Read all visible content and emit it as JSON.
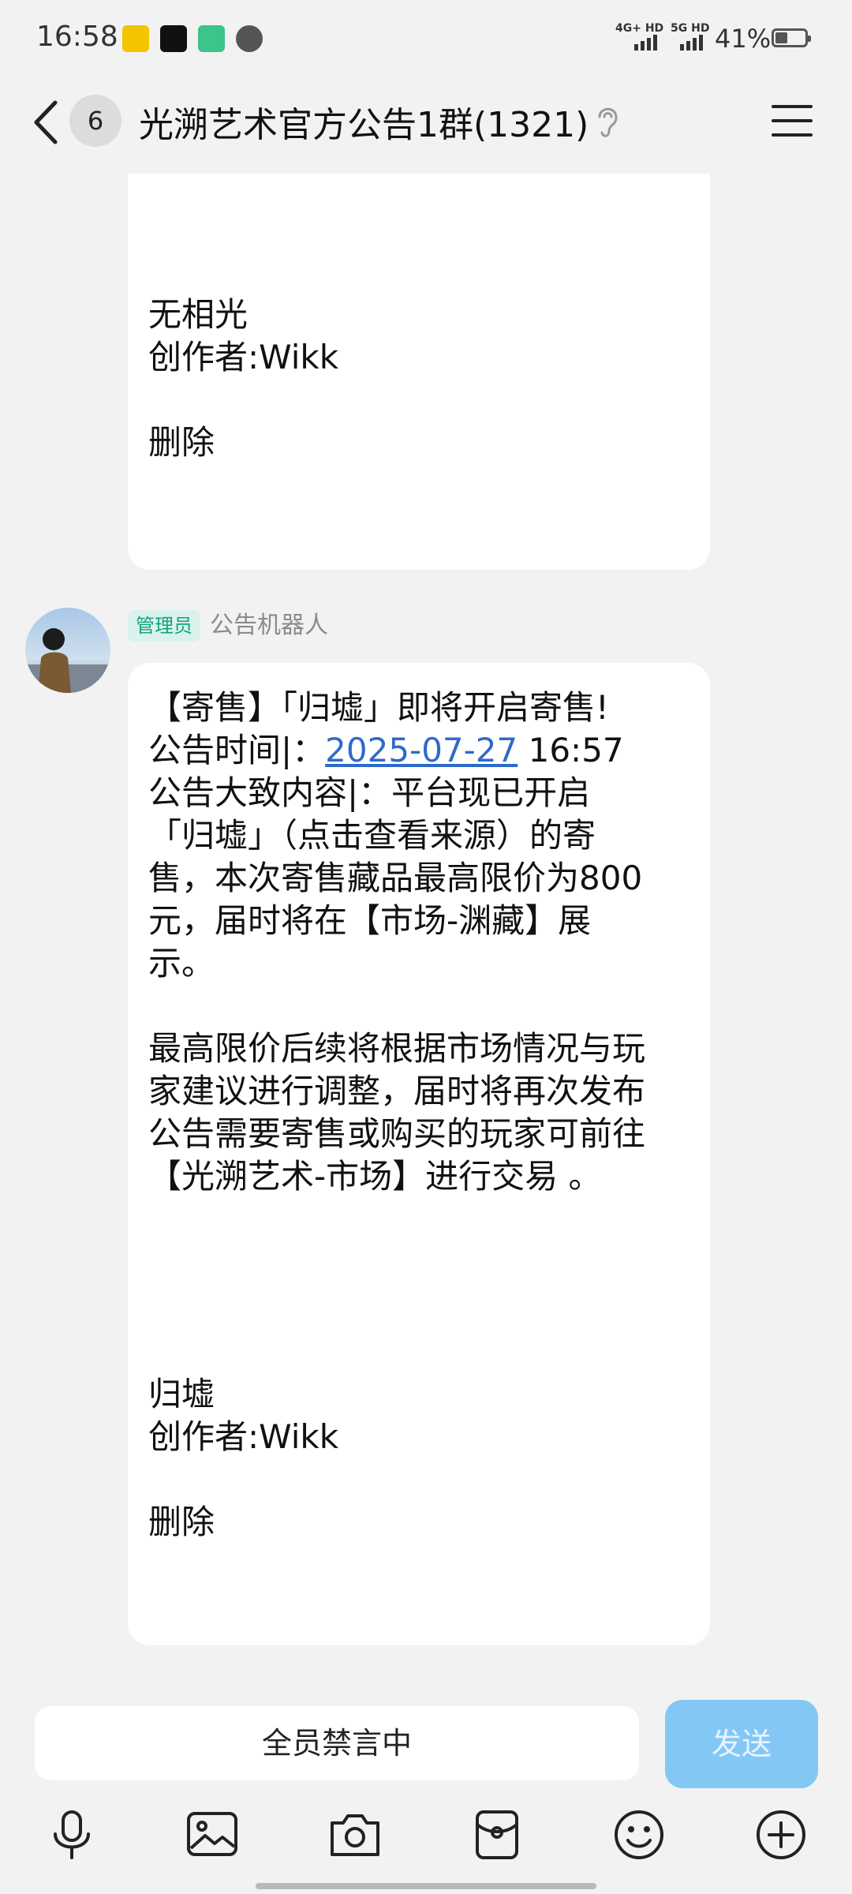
{
  "status_bar": {
    "time": "16:58",
    "signal1": "4G+ HD",
    "signal2": "5G HD",
    "battery_text": "41%",
    "battery_level": 0.41
  },
  "header": {
    "back_icon": "chevron-left-icon",
    "unread_count": "6",
    "title": "光溯艺术官方公告1群(1321)",
    "ear_icon": "ear-icon",
    "menu_icon": "menu-icon"
  },
  "messages": [
    {
      "body": "无相光\n创作者:Wikk\n\n删除"
    },
    {
      "role": "管理员",
      "sender": "公告机器人",
      "line1": "【寄售】「归墟」即将开启寄售!",
      "time_prefix": "公告时间|：",
      "date_link": "2025-07-27",
      "time_suffix": " 16:57",
      "content": "公告大致内容|：平台现已开启\n「归墟」（点击查看来源）的寄\n售，本次寄售藏品最高限价为800\n元，届时将在【市场-渊藏】展\n示。\n\n最高限价后续将根据市场情况与玩\n家建议进行调整，届时将再次发布\n公告需要寄售或购买的玩家可前往\n【光溯艺术-市场】进行交易 。",
      "footer": "归墟\n创作者:Wikk\n\n删除"
    }
  ],
  "input": {
    "muted_text": "全员禁言中",
    "send_label": "发送"
  },
  "toolbar": [
    "microphone-icon",
    "image-icon",
    "camera-icon",
    "red-packet-icon",
    "emoji-icon",
    "plus-icon"
  ]
}
